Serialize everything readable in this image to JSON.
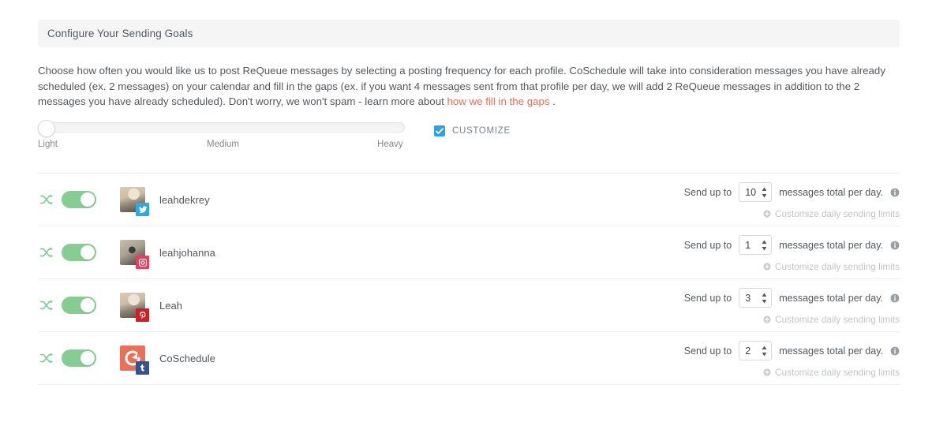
{
  "panel": {
    "header_title": "Configure Your Sending Goals"
  },
  "intro": {
    "text_before_link": "Choose how often you would like us to post ReQueue messages by selecting a posting frequency for each profile. CoSchedule will take into consideration messages you have already scheduled (ex. 2 messages) on your calendar and fill in the gaps (ex. if you want 4 messages sent from that profile per day, we will add 2 ReQueue messages in addition to the 2 messages you have already scheduled). Don't worry, we won't spam - learn more about ",
    "link_text": "how we fill in the gaps",
    "text_after_link": " .",
    "link_color": "#e0705a"
  },
  "frequency_slider": {
    "value_label": "Light",
    "position_percent": 0,
    "ticks": [
      "Light",
      "Medium",
      "Heavy"
    ],
    "labels": {
      "light": "Light",
      "medium": "Medium",
      "heavy": "Heavy"
    }
  },
  "customize": {
    "label": "CUSTOMIZE",
    "checked": true,
    "checkbox_color": "#2f9fe8",
    "icon": "check-icon"
  },
  "row_labels": {
    "send_up_to": "Send up to",
    "messages_total_per_day": "messages total per day.",
    "customize_limits": "Customize daily sending limits",
    "info_icon": "info-icon",
    "plus_icon": "circle-plus-icon",
    "shuffle_icon": "shuffle-icon",
    "spinner_icon": "spinner-arrows-icon"
  },
  "colors": {
    "toggle_on": "#86cd93",
    "shuffle": "#7ac893",
    "twitter": "#2daae1",
    "instagram": "#e4405f",
    "pinterest": "#cb2027",
    "tumblr": "#35538a",
    "coschedule": "#e8705a",
    "header_bg": "#f5f5f6"
  },
  "profiles": [
    {
      "name": "leahdekrey",
      "network": "twitter",
      "network_badge_icon": "twitter-icon",
      "enabled": true,
      "limit": "10"
    },
    {
      "name": "leahjohanna",
      "network": "instagram",
      "network_badge_icon": "instagram-icon",
      "enabled": true,
      "limit": "1"
    },
    {
      "name": "Leah",
      "network": "pinterest",
      "network_badge_icon": "pinterest-icon",
      "enabled": true,
      "limit": "3"
    },
    {
      "name": "CoSchedule",
      "network": "tumblr",
      "network_badge_icon": "tumblr-icon",
      "enabled": true,
      "limit": "2"
    }
  ]
}
